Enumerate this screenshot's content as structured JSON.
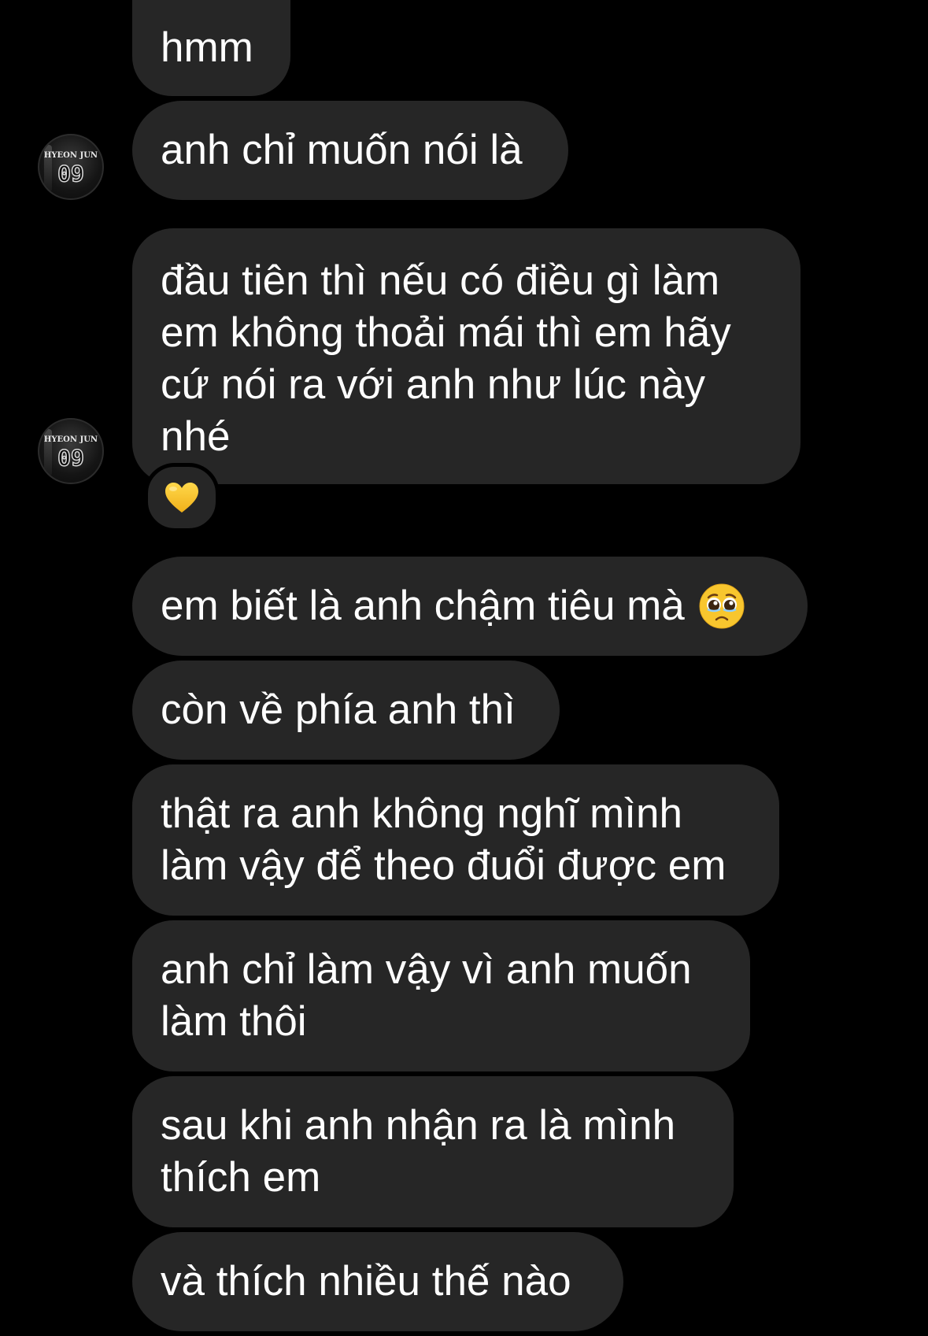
{
  "thread": {
    "messages": [
      {
        "text": "hmm"
      },
      {
        "text": "anh chỉ muốn nói là"
      },
      {
        "text": "đầu tiên thì nếu có điều gì làm\nem không thoải mái thì em hãy\ncứ nói ra với anh như lúc này\nnhé"
      },
      {
        "text": "em biết là anh chậm tiêu mà"
      },
      {
        "text": "còn về phía anh thì"
      },
      {
        "text": "thật ra anh không nghĩ mình\nlàm vậy để theo đuổi được em"
      },
      {
        "text": "anh chỉ làm vậy vì anh muốn\nlàm thôi"
      },
      {
        "text": "sau khi anh nhận ra là mình\nthích em"
      },
      {
        "text": "và thích nhiều thế nào"
      }
    ],
    "reaction": {
      "icon": "yellow-heart-icon"
    },
    "inline_emoji": {
      "icon": "pleading-face-icon"
    },
    "avatar": {
      "name": "HYEON JUN",
      "number": "09"
    }
  },
  "colors": {
    "background": "#000000",
    "bubble": "#262626",
    "text": "#ffffff",
    "heart": "#f7c52b",
    "emoji_face": "#f8c62e"
  }
}
